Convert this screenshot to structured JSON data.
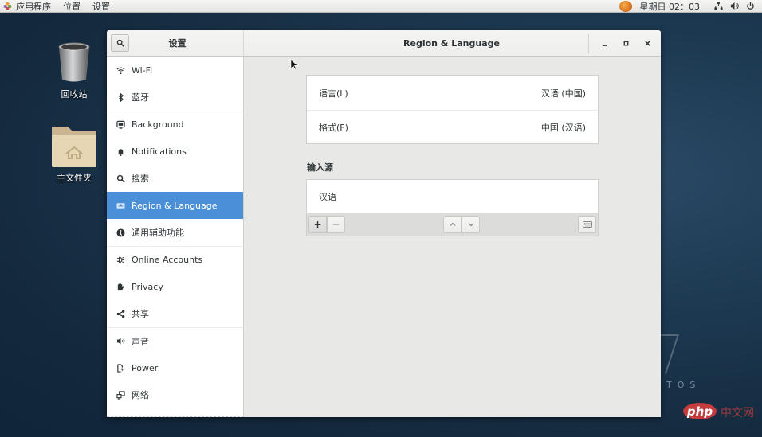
{
  "topbar": {
    "menus": [
      "应用程序",
      "位置",
      "设置"
    ],
    "clock": "星期日 02：03",
    "tray_icons": [
      "network-icon",
      "volume-icon",
      "power-icon"
    ]
  },
  "desktop": {
    "icons": [
      {
        "label": "回收站",
        "icon": "trash-icon"
      },
      {
        "label": "主文件夹",
        "icon": "home-folder-icon"
      }
    ],
    "watermark": {
      "brand_text": "TOS",
      "site_logo": "php",
      "site_text": "中文网"
    }
  },
  "window": {
    "sidebar_title": "设置",
    "title": "Region & Language",
    "controls": [
      "minimize",
      "maximize",
      "close"
    ]
  },
  "sidebar": {
    "items": [
      {
        "label": "Wi-Fi",
        "icon": "wifi-icon"
      },
      {
        "label": "蓝牙",
        "icon": "bluetooth-icon"
      },
      {
        "label": "Background",
        "icon": "background-icon"
      },
      {
        "label": "Notifications",
        "icon": "bell-icon"
      },
      {
        "label": "搜索",
        "icon": "search-icon"
      },
      {
        "label": "Region & Language",
        "icon": "region-icon",
        "active": true
      },
      {
        "label": "通用辅助功能",
        "icon": "accessibility-icon"
      },
      {
        "label": "Online Accounts",
        "icon": "online-accounts-icon"
      },
      {
        "label": "Privacy",
        "icon": "privacy-hand-icon"
      },
      {
        "label": "共享",
        "icon": "share-icon"
      },
      {
        "label": "声音",
        "icon": "sound-icon"
      },
      {
        "label": "Power",
        "icon": "power-icon"
      },
      {
        "label": "网络",
        "icon": "network-icon"
      }
    ]
  },
  "region": {
    "language_label": "语言(L)",
    "language_value": "汉语 (中国)",
    "formats_label": "格式(F)",
    "formats_value": "中国 (汉语)",
    "input_sources_heading": "输入源",
    "input_sources": [
      "汉语"
    ],
    "toolbar": {
      "add": "+",
      "remove": "−"
    }
  }
}
